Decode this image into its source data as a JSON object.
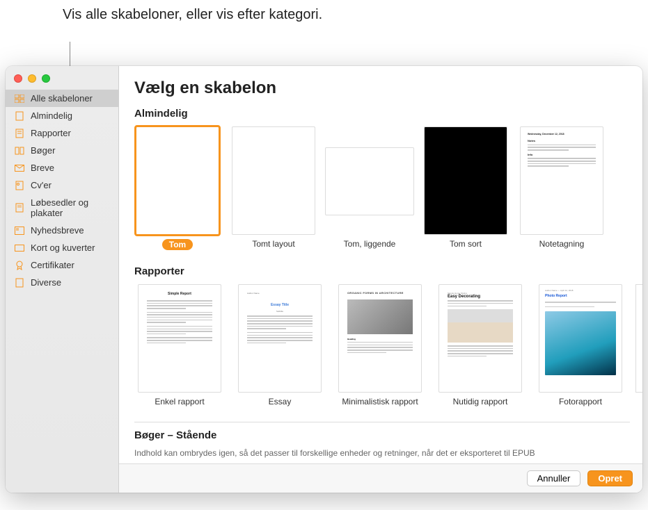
{
  "callout": "Vis alle skabeloner, eller vis efter kategori.",
  "page_title": "Vælg en skabelon",
  "sidebar": {
    "items": [
      {
        "label": "Alle skabeloner",
        "icon": "grid"
      },
      {
        "label": "Almindelig",
        "icon": "doc"
      },
      {
        "label": "Rapporter",
        "icon": "doc"
      },
      {
        "label": "Bøger",
        "icon": "book"
      },
      {
        "label": "Breve",
        "icon": "envelope"
      },
      {
        "label": "Cv'er",
        "icon": "doc"
      },
      {
        "label": "Løbesedler og plakater",
        "icon": "poster"
      },
      {
        "label": "Nyhedsbreve",
        "icon": "news"
      },
      {
        "label": "Kort og kuverter",
        "icon": "card"
      },
      {
        "label": "Certifikater",
        "icon": "ribbon"
      },
      {
        "label": "Diverse",
        "icon": "doc"
      }
    ]
  },
  "sections": {
    "almindelig": {
      "title": "Almindelig",
      "tiles": [
        {
          "label": "Tom"
        },
        {
          "label": "Tomt layout"
        },
        {
          "label": "Tom, liggende"
        },
        {
          "label": "Tom sort"
        },
        {
          "label": "Notetagning"
        }
      ]
    },
    "rapporter": {
      "title": "Rapporter",
      "tiles": [
        {
          "label": "Enkel rapport",
          "thumb_title": "Simple Report"
        },
        {
          "label": "Essay",
          "thumb_title": "Essay Title",
          "thumb_sub": "Subtitle"
        },
        {
          "label": "Minimalistisk rapport",
          "thumb_title": "ORGANIC FORMS IN ARCHITECTURE"
        },
        {
          "label": "Nutidig rapport",
          "thumb_title": "Easy Decorating",
          "thumb_kicker": "Simple Home Styling"
        },
        {
          "label": "Fotorapport",
          "thumb_title": "Photo Report"
        }
      ]
    },
    "boger": {
      "title": "Bøger – Stående",
      "subtext": "Indhold kan ombrydes igen, så det passer til forskellige enheder og retninger, når det er eksporteret til EPUB"
    }
  },
  "footer": {
    "cancel": "Annuller",
    "create": "Opret"
  }
}
